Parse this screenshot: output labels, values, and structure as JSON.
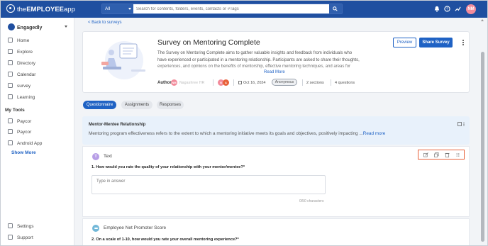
{
  "app": {
    "name_prefix": "the",
    "name_main": "EMPLOYEE",
    "name_suffix": "app"
  },
  "search": {
    "scope": "All",
    "placeholder": "Search for contents, folders, events, contacts or #Tags"
  },
  "user": {
    "initials": "NM"
  },
  "sidebar": {
    "org": "Engagedly",
    "items": [
      {
        "label": "Home",
        "icon": "home-icon"
      },
      {
        "label": "Explore",
        "icon": "explore-icon"
      },
      {
        "label": "Directory",
        "icon": "directory-icon"
      },
      {
        "label": "Calendar",
        "icon": "calendar-icon"
      },
      {
        "label": "survey",
        "icon": "survey-icon"
      },
      {
        "label": "Learning",
        "icon": "learning-icon"
      }
    ],
    "my_tools_label": "My Tools",
    "tools": [
      {
        "label": "Paycor",
        "icon": "link-icon"
      },
      {
        "label": "Paycor",
        "icon": "link-icon"
      },
      {
        "label": "Android App",
        "icon": "link-icon"
      }
    ],
    "show_more": "Show More",
    "footer": [
      {
        "label": "Settings",
        "icon": "settings-icon"
      },
      {
        "label": "Support",
        "icon": "support-icon"
      }
    ]
  },
  "back_link": "< Back to surveys",
  "survey": {
    "title": "Survey on Mentoring Complete",
    "description": "The Survey on Mentoring Complete aims to gather valuable insights and feedback from individuals who have experienced or participated in a mentoring relationship. Participants are asked to share their thoughts, experiences, and opinions on the benefits of mentorship, effective mentoring techniques, and areas for improvement within the mentorship process. This survey will provide key information to help us enhance mentoring programs.",
    "read_more": "Read More",
    "author_label": "Author",
    "author_initials": "NM",
    "author_name": "Nagashree HR",
    "collab_initials": [
      "N",
      "A"
    ],
    "date": "Oct 16, 2024",
    "privacy": "Anonymous",
    "sections": "2 sections",
    "questions": "4 questions",
    "preview_label": "Preview",
    "share_label": "Share Survey"
  },
  "tabs": [
    {
      "label": "Questionnaire",
      "active": true
    },
    {
      "label": "Assignments",
      "active": false
    },
    {
      "label": "Responses",
      "active": false
    }
  ],
  "section": {
    "title": "Mentor-Mentee Relationship",
    "description": "Mentoring program effectiveness refers to the extent to which a mentoring initiative meets its goals and objectives, positively impacting ...",
    "more": "Read more"
  },
  "question1": {
    "type_badge": "T",
    "type": "Text",
    "text": "1. How would you rate the quality of your relationship with your mentor/mentee?*",
    "placeholder": "Type in answer",
    "char_count": "0/50 characters"
  },
  "question2": {
    "type": "Employee Net Promoter Score",
    "text": "2. On a scale of 1-10, how would you rate your overall mentoring experience?*"
  },
  "colors": {
    "brand": "#1f4fa0",
    "accent": "#1f62c4",
    "highlight": "#e8623a",
    "section_bg": "#e8f1fb"
  }
}
